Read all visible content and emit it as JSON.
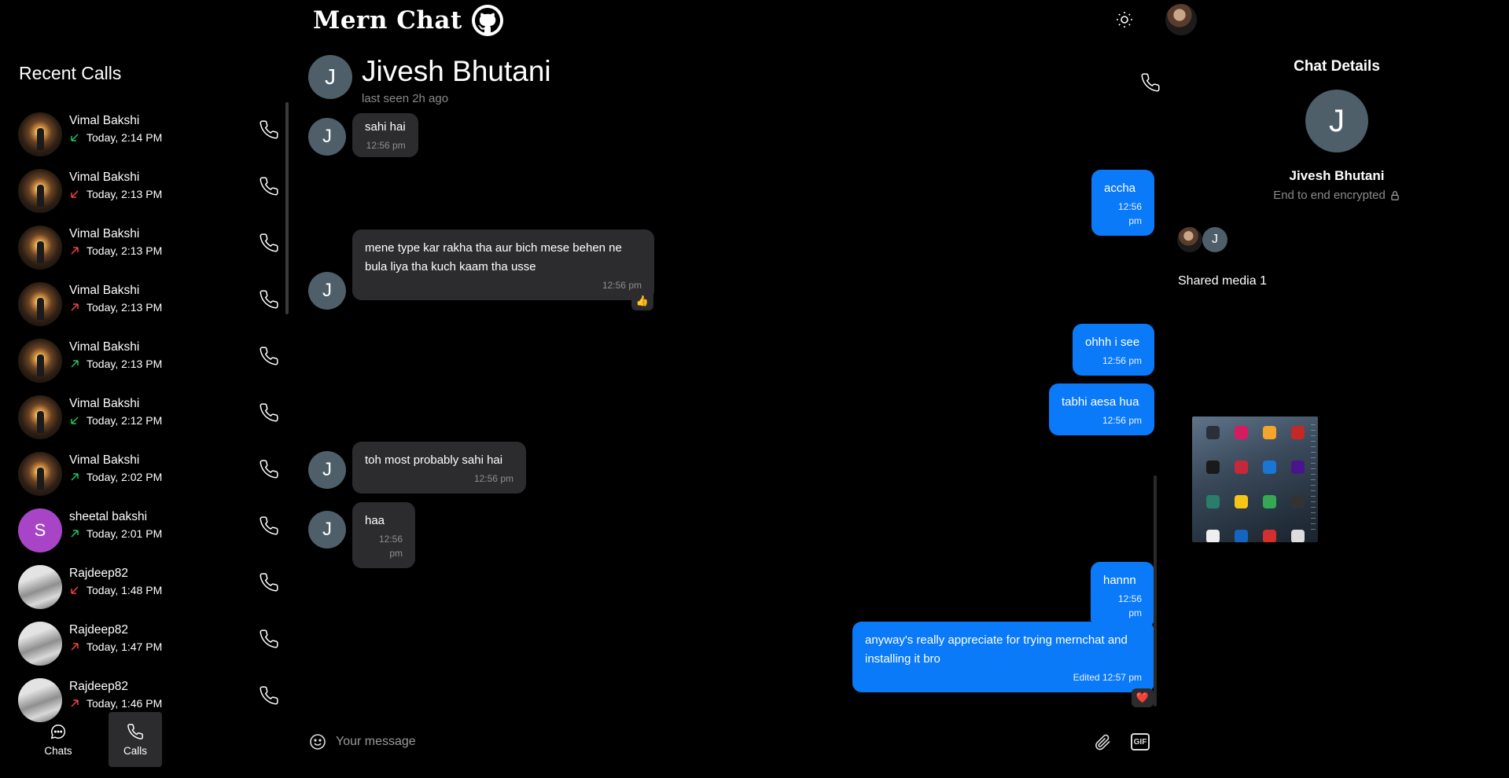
{
  "header": {
    "brand": "Mern Chat"
  },
  "left": {
    "title": "Recent Calls",
    "calls": [
      {
        "name": "Vimal Bakshi",
        "time": "Today, 2:14 PM",
        "direction": "incoming",
        "color": "#22c55e",
        "avatar": "vimal"
      },
      {
        "name": "Vimal Bakshi",
        "time": "Today, 2:13 PM",
        "direction": "incoming",
        "color": "#ef4444",
        "avatar": "vimal"
      },
      {
        "name": "Vimal Bakshi",
        "time": "Today, 2:13 PM",
        "direction": "outgoing",
        "color": "#ef4444",
        "avatar": "vimal"
      },
      {
        "name": "Vimal Bakshi",
        "time": "Today, 2:13 PM",
        "direction": "outgoing",
        "color": "#ef4444",
        "avatar": "vimal"
      },
      {
        "name": "Vimal Bakshi",
        "time": "Today, 2:13 PM",
        "direction": "outgoing",
        "color": "#22c55e",
        "avatar": "vimal"
      },
      {
        "name": "Vimal Bakshi",
        "time": "Today, 2:12 PM",
        "direction": "incoming",
        "color": "#22c55e",
        "avatar": "vimal"
      },
      {
        "name": "Vimal Bakshi",
        "time": "Today, 2:02 PM",
        "direction": "outgoing",
        "color": "#22c55e",
        "avatar": "vimal"
      },
      {
        "name": "sheetal bakshi",
        "time": "Today, 2:01 PM",
        "direction": "outgoing",
        "color": "#22c55e",
        "avatar": "letter",
        "initial": "S"
      },
      {
        "name": "Rajdeep82",
        "time": "Today, 1:48 PM",
        "direction": "incoming",
        "color": "#ef4444",
        "avatar": "raj"
      },
      {
        "name": "Rajdeep82",
        "time": "Today, 1:47 PM",
        "direction": "outgoing",
        "color": "#ef4444",
        "avatar": "raj"
      },
      {
        "name": "Rajdeep82",
        "time": "Today, 1:46 PM",
        "direction": "outgoing",
        "color": "#ef4444",
        "avatar": "raj"
      }
    ]
  },
  "nav": {
    "chats_label": "Chats",
    "calls_label": "Calls"
  },
  "chat": {
    "initial": "J",
    "name": "Jivesh Bhutani",
    "last_seen": "last seen 2h ago",
    "messages": {
      "m1": {
        "text": "sahi hai",
        "time": "12:56 pm"
      },
      "m2": {
        "text": "accha",
        "time": "12:56 pm"
      },
      "m3": {
        "text": "mene type kar rakha tha aur bich mese behen ne bula liya tha kuch kaam tha usse",
        "time": "12:56 pm",
        "reaction": "👍"
      },
      "m4": {
        "text": "ohhh i see",
        "time": "12:56 pm"
      },
      "m5": {
        "text": "tabhi aesa hua",
        "time": "12:56 pm"
      },
      "m6": {
        "text": "toh most probably sahi hai",
        "time": "12:56 pm"
      },
      "m7": {
        "text": "haa",
        "time": "12:56 pm"
      },
      "m8": {
        "text": "hannn",
        "time": "12:56 pm"
      },
      "m9": {
        "text": "anyway's really appreciate for trying mernchat and installing it bro",
        "edited": "Edited",
        "time": "12:57 pm",
        "reaction": "❤️"
      }
    },
    "composer_placeholder": "Your message",
    "gif_label": "GIF"
  },
  "details": {
    "title": "Chat Details",
    "initial": "J",
    "name": "Jivesh Bhutani",
    "encryption": "End to end encrypted",
    "member_initial": "J",
    "shared_media": "Shared media 1"
  }
}
